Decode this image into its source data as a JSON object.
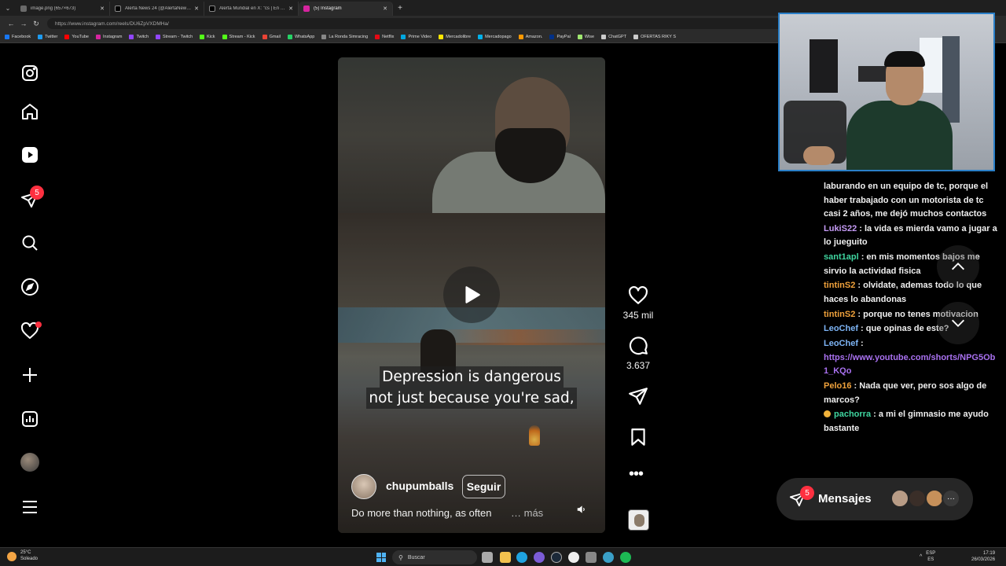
{
  "browser": {
    "tabs": [
      {
        "title": "image.png (657×673)",
        "active": false,
        "color": "#6a6a6a"
      },
      {
        "title": "Alerta News 24 (@AlertaNews24) / X",
        "active": false,
        "color": "#000000"
      },
      {
        "title": "Alerta Mundial en X: \"cs | En unas…",
        "active": false,
        "color": "#000000"
      },
      {
        "title": "(5) Instagram",
        "active": true,
        "color": "#d6249f"
      }
    ],
    "url": "https://www.instagram.com/reels/DU6ZpVXDMHa/",
    "bookmarks": [
      {
        "label": "Facebook",
        "color": "#1877f2"
      },
      {
        "label": "Twitter",
        "color": "#1d9bf0"
      },
      {
        "label": "YouTube",
        "color": "#ff0000"
      },
      {
        "label": "Instagram",
        "color": "#d6249f"
      },
      {
        "label": "Twitch",
        "color": "#9146ff"
      },
      {
        "label": "Stream - Twitch",
        "color": "#9146ff"
      },
      {
        "label": "Kick",
        "color": "#53fc18"
      },
      {
        "label": "Stream - Kick",
        "color": "#53fc18"
      },
      {
        "label": "Gmail",
        "color": "#ea4335"
      },
      {
        "label": "WhatsApp",
        "color": "#25d366"
      },
      {
        "label": "La Ronda Simracing",
        "color": "#888888"
      },
      {
        "label": "Netflix",
        "color": "#e50914"
      },
      {
        "label": "Prime Video",
        "color": "#00a8e1"
      },
      {
        "label": "Mercadolibre",
        "color": "#ffe600"
      },
      {
        "label": "Mercadopago",
        "color": "#00b1ea"
      },
      {
        "label": "Amazon.",
        "color": "#ff9900"
      },
      {
        "label": "PayPal",
        "color": "#003087"
      },
      {
        "label": "Wise",
        "color": "#9fe870"
      },
      {
        "label": "ChatGPT",
        "color": "#cccccc"
      },
      {
        "label": "OFERTAS RIKY S",
        "color": "#cccccc"
      }
    ]
  },
  "sidebar": {
    "notifications_badge": "5"
  },
  "reel": {
    "subtitle_line1": "Depression is dangerous",
    "subtitle_line2": "not just because you're sad,",
    "author": "chupumballs",
    "follow_label": "Seguir",
    "caption": "Do more than nothing, as often",
    "more_label": "… más",
    "likes": "345 mil",
    "comments": "3.637"
  },
  "chat": [
    {
      "user": "",
      "color": "",
      "text": "laburando en un equipo de tc, porque el haber trabajado con un motorista de tc casi 2 años, me dejó muchos contactos"
    },
    {
      "user": "LukiS22",
      "color": "#c59bf5",
      "text": "la vida es mierda vamo a jugar a lo jueguito"
    },
    {
      "user": "sant1apl",
      "color": "#3fd6a0",
      "text": "en mis momentos bajos me sirvio la actividad fisica"
    },
    {
      "user": "tintinS2",
      "color": "#f0a23c",
      "text": "olvidate, ademas todo lo que haces lo abandonas"
    },
    {
      "user": "tintinS2",
      "color": "#f0a23c",
      "text": "porque no tenes motivacion"
    },
    {
      "user": "LeoChef",
      "color": "#7db4f5",
      "text": "que opinas de este?"
    },
    {
      "user": "LeoChef",
      "color": "#7db4f5",
      "text": "",
      "link": "https://www.youtube.com/shorts/NPG5Ob1_KQo"
    },
    {
      "user": "Pelo16",
      "color": "#f0a23c",
      "text": "Nada que ver, pero sos algo de marcos?"
    },
    {
      "user": "pachorra",
      "color": "#3fd6a0",
      "text": "a mi el gimnasio me ayudo bastante"
    }
  ],
  "messages": {
    "label": "Mensajes",
    "badge": "5",
    "more": "···"
  },
  "taskbar": {
    "temperature": "25°C",
    "weather": "Soleado",
    "search_label": "Buscar",
    "lang_top": "ESP",
    "lang_bottom": "ES",
    "time": "17:19",
    "date": "26/03/2026"
  }
}
